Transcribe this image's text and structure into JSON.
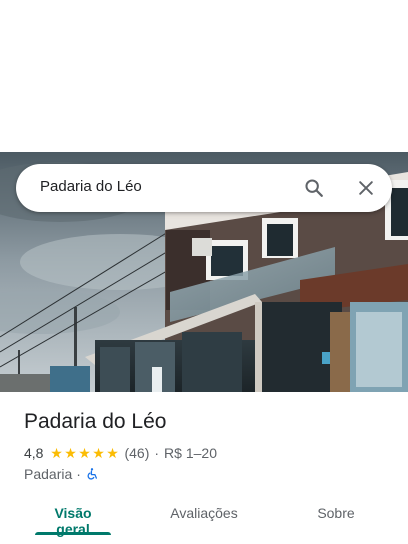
{
  "search": {
    "query": "Padaria do Léo",
    "search_icon": "search-icon",
    "close_icon": "close-icon"
  },
  "place": {
    "name": "Padaria do Léo",
    "rating": "4,8",
    "rating_value": 4.8,
    "stars_max": 5,
    "reviews": "(46)",
    "separator": "·",
    "price": "R$ 1–20",
    "category": "Padaria",
    "category_separator": "·",
    "accessibility_icon": "wheelchair-icon"
  },
  "tabs": [
    {
      "label": "Visão geral",
      "active": true
    },
    {
      "label": "Avaliações",
      "active": false
    },
    {
      "label": "Sobre",
      "active": false
    }
  ],
  "colors": {
    "accent": "#00796b",
    "star": "#fbbc04",
    "accessibility": "#1a73e8",
    "text_primary": "#202124",
    "text_secondary": "#5f6368"
  }
}
